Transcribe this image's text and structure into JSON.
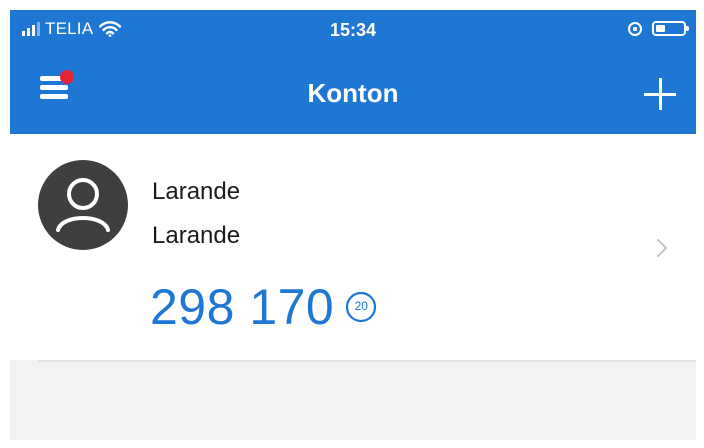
{
  "status_bar": {
    "carrier": "TELIA",
    "time": "15:34",
    "icons": [
      "signal-icon",
      "wifi-icon",
      "rotation-lock-icon",
      "battery-icon"
    ],
    "battery_level": 0.35
  },
  "header": {
    "title": "Konton",
    "menu_icon": "hamburger-menu-icon",
    "has_notification": true,
    "add_icon": "plus-icon",
    "background": "#1f77d4"
  },
  "accounts": [
    {
      "name": "Larande",
      "subname": "Larande",
      "code": "298 170",
      "timer": "20",
      "avatar_icon": "user-avatar-icon",
      "chevron_icon": "chevron-right-icon"
    }
  ],
  "colors": {
    "accent": "#1f77d4",
    "notification": "#e2263a",
    "avatar_bg": "#3f3f3f"
  }
}
